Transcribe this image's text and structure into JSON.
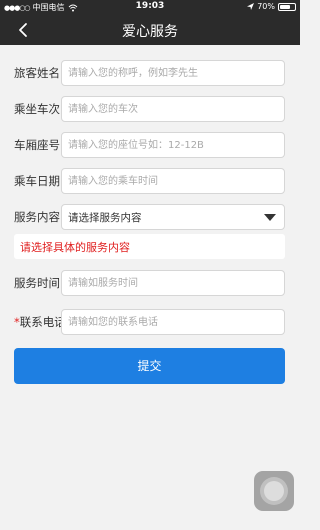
{
  "status_bar": {
    "carrier": "中国电信",
    "time": "19:03",
    "battery_text": "70%",
    "battery_level": 0.7
  },
  "nav": {
    "title": "爱心服务"
  },
  "form": {
    "name": {
      "label": "旅客姓名",
      "placeholder": "请输入您的称呼，例如李先生"
    },
    "train": {
      "label": "乘坐车次",
      "placeholder": "请输入您的车次"
    },
    "seat": {
      "label": "车厢座号",
      "placeholder": "请输入您的座位号如：12-12B"
    },
    "date": {
      "label": "乘车日期",
      "placeholder": "请输入您的乘车时间"
    },
    "service": {
      "label": "服务内容",
      "selected": "请选择服务内容"
    },
    "error": "请选择具体的服务内容",
    "service_time": {
      "label": "服务时间",
      "placeholder": "请输如服务时间"
    },
    "phone": {
      "required_mark": "*",
      "label": "联系电话",
      "placeholder": "请输如您的联系电话"
    },
    "submit_label": "提交"
  },
  "colors": {
    "accent": "#1e7fe2",
    "error": "#e02020",
    "header": "#2b2b2b"
  }
}
